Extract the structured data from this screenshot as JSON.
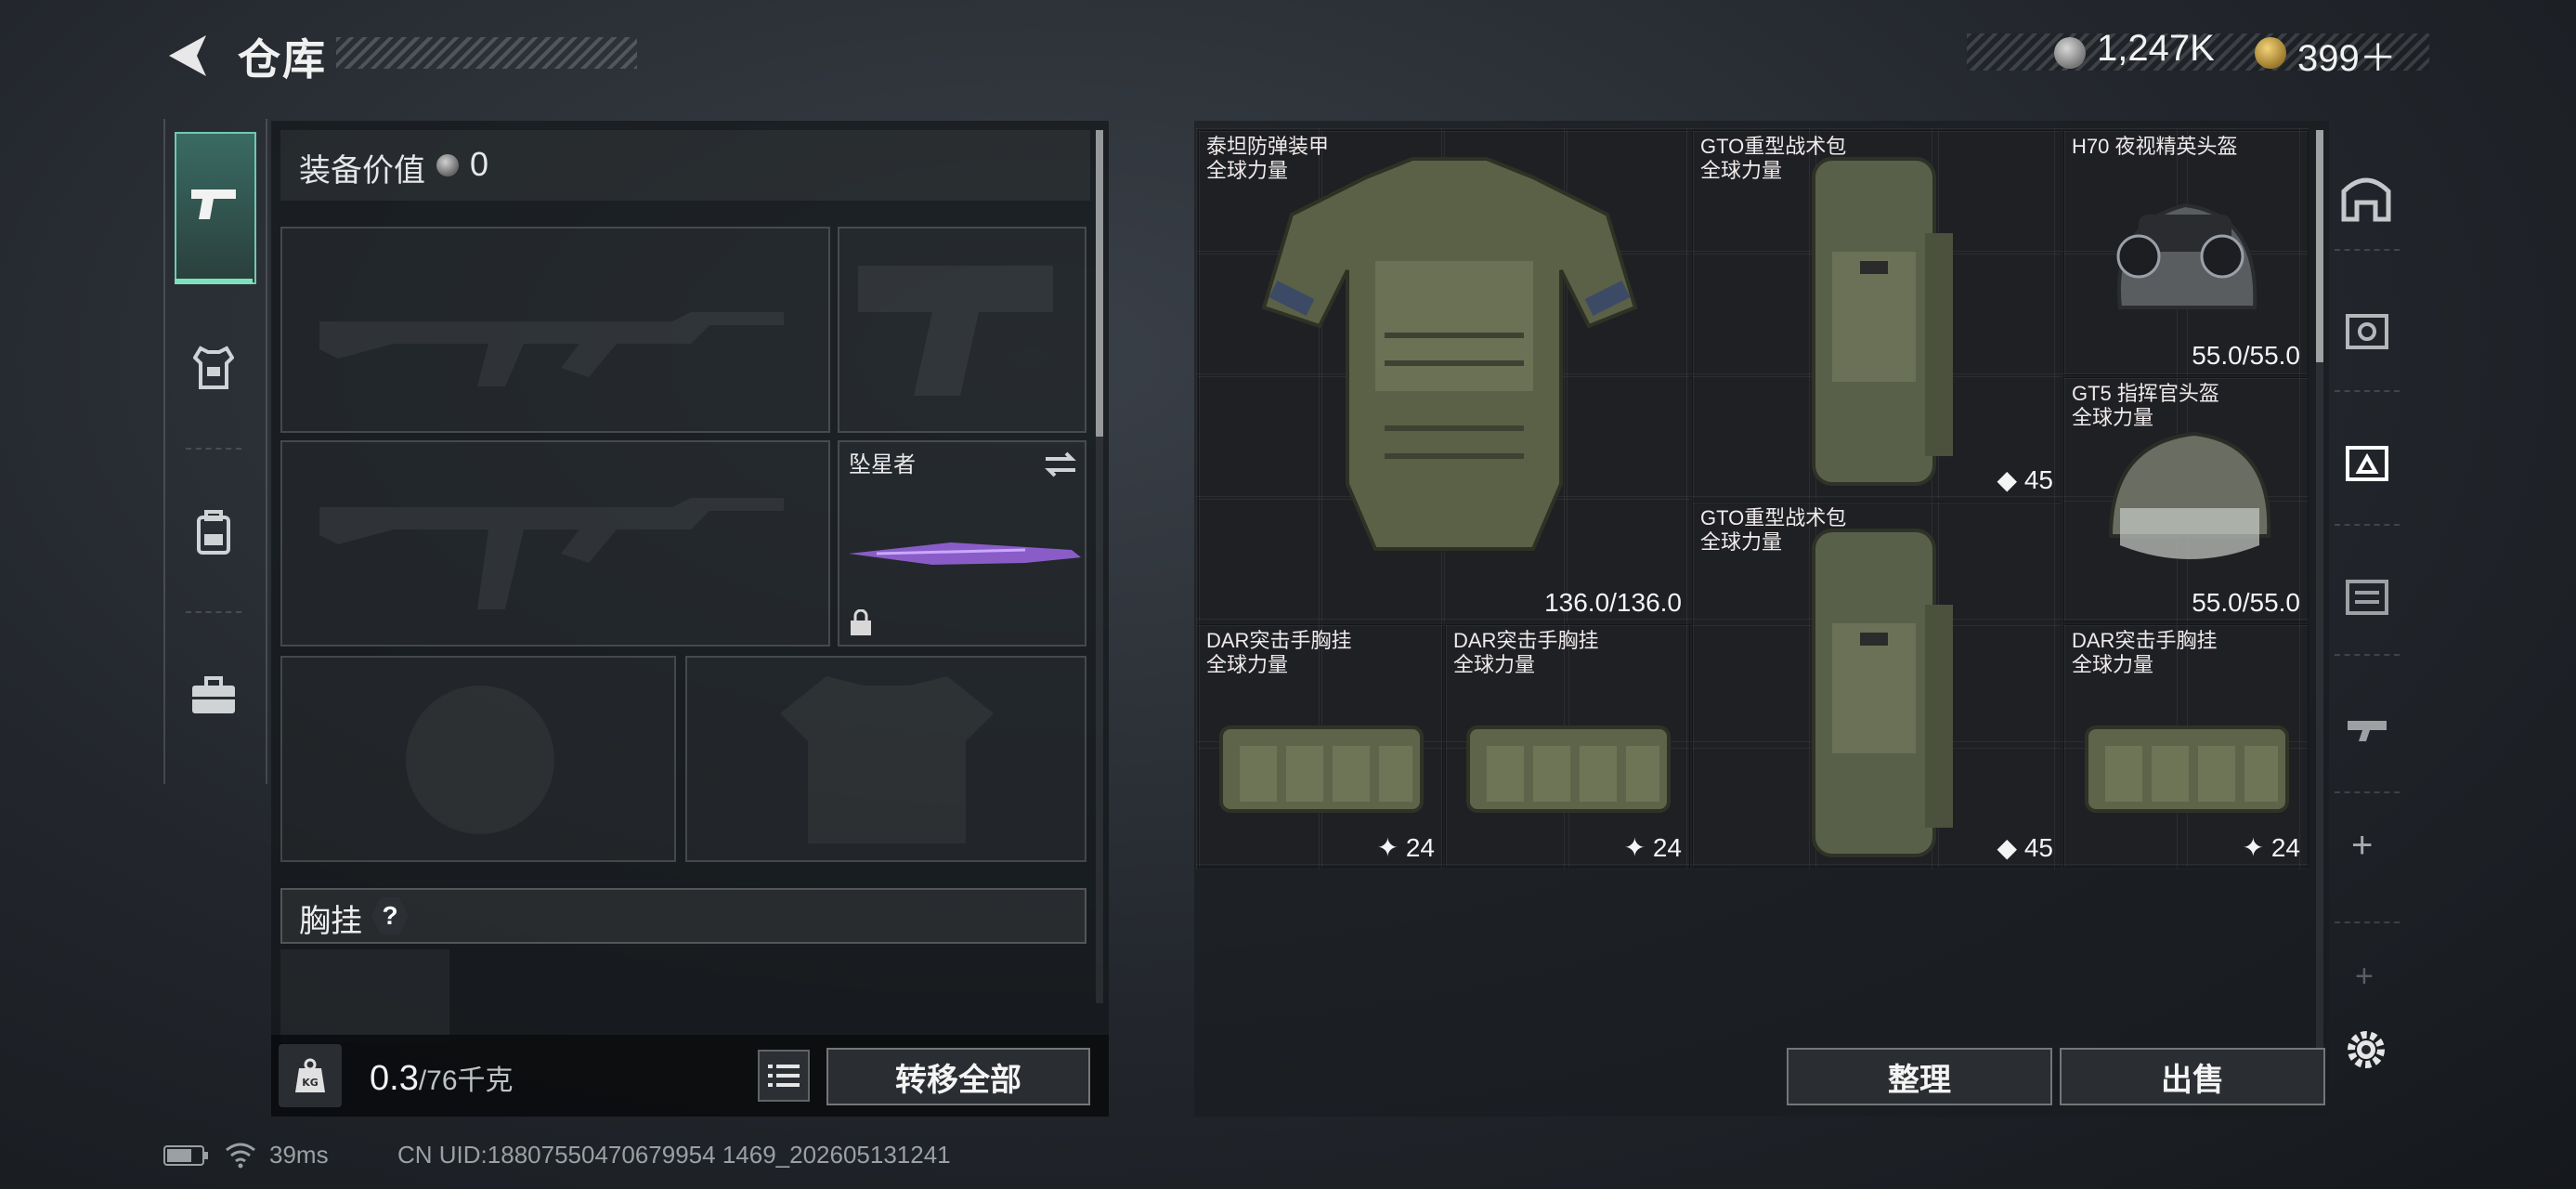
{
  "header": {
    "title": "仓库",
    "silver": "1,247K",
    "gold": "399＋"
  },
  "equipment": {
    "value_label": "装备价值",
    "value": "0",
    "weapon_slot_name": "坠星者",
    "vest_label": "胸挂",
    "help": "?",
    "weight_current": "0.3",
    "weight_max": "/76千克",
    "kg_icon_label": "KG",
    "transfer_all": "转移全部"
  },
  "stash": {
    "items": [
      {
        "name": "泰坦防弹装甲",
        "sub": "全球力量",
        "stat": "136.0/136.0",
        "icon": "armor-vest-icon",
        "color": "red"
      },
      {
        "name": "GTO重型战术包",
        "sub": "全球力量",
        "stat": "45",
        "icon": "backpack-icon",
        "color": "red"
      },
      {
        "name": "H70 夜视精英头盔",
        "sub": "",
        "stat": "55.0/55.0",
        "icon": "helmet-nvg-icon",
        "color": "red"
      },
      {
        "name": "GT5 指挥官头盔",
        "sub": "全球力量",
        "stat": "55.0/55.0",
        "icon": "helmet-icon",
        "color": "red"
      },
      {
        "name": "GTO重型战术包",
        "sub": "全球力量",
        "stat": "45",
        "icon": "backpack-icon",
        "color": "red"
      },
      {
        "name": "DAR突击手胸挂",
        "sub": "全球力量",
        "stat": "24",
        "icon": "chest-rig-icon",
        "color": "olive"
      },
      {
        "name": "DAR突击手胸挂",
        "sub": "全球力量",
        "stat": "24",
        "icon": "chest-rig-icon",
        "color": "olive"
      },
      {
        "name": "DAR突击手胸挂",
        "sub": "全球力量",
        "stat": "24",
        "icon": "chest-rig-icon",
        "color": "olive"
      }
    ],
    "sort": "整理",
    "sell": "出售",
    "side_tab_plus": "+"
  },
  "status_bar": {
    "ping": "39ms",
    "uid": "CN UID:18807550470679954 1469_202605131241"
  },
  "colors": {
    "accent": "#6fc9b0",
    "item_red": "#6a2c30",
    "item_olive": "#4a4436"
  }
}
